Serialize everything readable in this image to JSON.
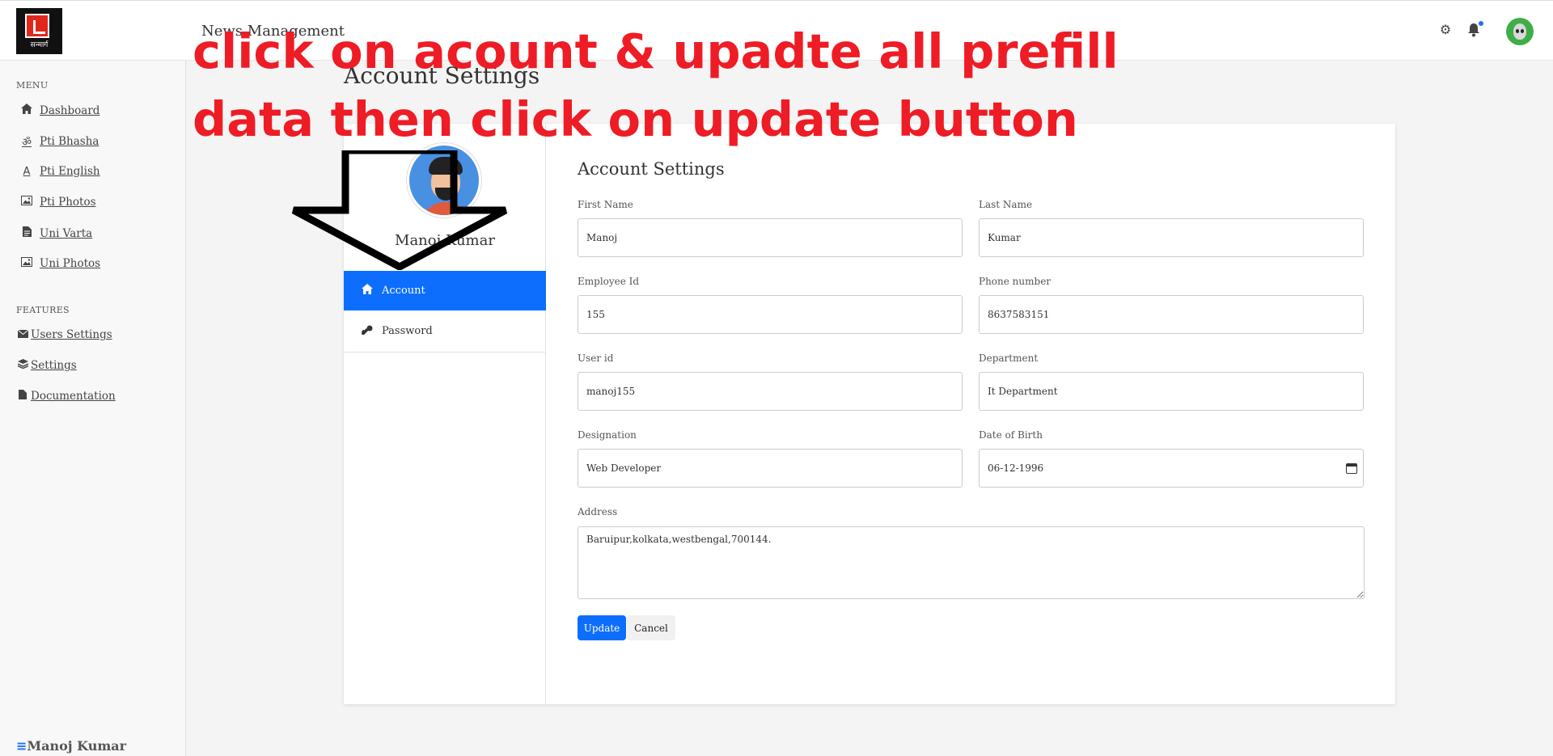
{
  "header": {
    "logo_text": "सन्मार्ग",
    "app_title": "News Management"
  },
  "sidebar": {
    "menu_title": "MENU",
    "menu_items": [
      {
        "label": "Dashboard",
        "icon": "home-icon"
      },
      {
        "label": "Pti Bhasha",
        "icon": "om-icon"
      },
      {
        "label": "Pti English",
        "icon": "letter-a-icon"
      },
      {
        "label": "Pti Photos",
        "icon": "image-icon"
      },
      {
        "label": "Uni Varta",
        "icon": "file-icon"
      },
      {
        "label": "Uni Photos",
        "icon": "image-icon"
      }
    ],
    "features_title": "FEATURES",
    "feature_items": [
      {
        "label": "Users Settings",
        "icon": "envelope-icon"
      },
      {
        "label": "Settings",
        "icon": "layers-icon"
      },
      {
        "label": "Documentation",
        "icon": "file-icon"
      }
    ],
    "user_name": "Manoj Kumar",
    "user_menu_glyph": "≡"
  },
  "page": {
    "title": "Account Settings"
  },
  "profile": {
    "name": "Manoj Kumar",
    "menu": {
      "account": "Account",
      "password": "Password"
    }
  },
  "form": {
    "title": "Account Settings",
    "fields": {
      "first_name": {
        "label": "First Name",
        "value": "Manoj"
      },
      "last_name": {
        "label": "Last Name",
        "value": "Kumar"
      },
      "employee_id": {
        "label": "Employee Id",
        "value": "155"
      },
      "phone": {
        "label": "Phone number",
        "value": "8637583151"
      },
      "user_id": {
        "label": "User id",
        "value": "manoj155"
      },
      "department": {
        "label": "Department",
        "value": "It Department"
      },
      "designation": {
        "label": "Designation",
        "value": "Web Developer"
      },
      "dob": {
        "label": "Date of Birth",
        "value": "06-12-1996"
      },
      "address": {
        "label": "Address",
        "value": "Baruipur,kolkata,westbengal,700144."
      }
    },
    "update_label": "Update",
    "cancel_label": "Cancel"
  },
  "annotation": {
    "line1": "click on acount & upadte all prefill",
    "line2": "data then click on update button",
    "color": "#ee1c25"
  },
  "colors": {
    "primary": "#0d6efd",
    "notification_dot": "#1f6fff"
  }
}
